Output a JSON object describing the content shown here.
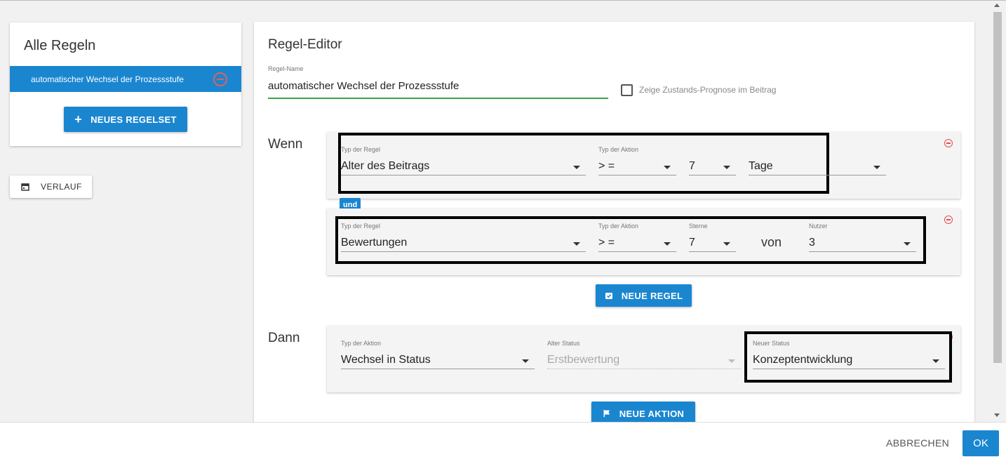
{
  "sidebar": {
    "title": "Alle Regeln",
    "rules": [
      {
        "label": "automatischer Wechsel der Prozessstufe"
      }
    ],
    "new_ruleset_label": "NEUES REGELSET",
    "history_label": "VERLAUF"
  },
  "editor": {
    "title": "Regel-Editor",
    "name_label": "Regel-Name",
    "name_value": "automatischer Wechsel der Prozessstufe",
    "forecast_checkbox_label": "Zeige Zustands-Prognose im Beitrag",
    "forecast_checked": false,
    "wenn_label": "Wenn",
    "dann_label": "Dann",
    "conditions": [
      {
        "rule_type_label": "Typ der Regel",
        "rule_type_value": "Alter des Beitrags",
        "action_type_label": "Typ der Aktion",
        "operator_value": "> =",
        "number_value": "7",
        "unit_value": "Tage"
      },
      {
        "rule_type_label": "Typ der Regel",
        "rule_type_value": "Bewertungen",
        "action_type_label": "Typ der Aktion",
        "operator_value": "> =",
        "stars_label": "Sterne",
        "stars_value": "7",
        "von_text": "von",
        "users_label": "Nutzer",
        "users_value": "3"
      }
    ],
    "connector_label": "und",
    "new_rule_label": "NEUE REGEL",
    "action": {
      "action_type_label": "Typ der Aktion",
      "action_type_value": "Wechsel in Status",
      "old_status_label": "Alter Status",
      "old_status_value": "Erstbewertung",
      "new_status_label": "Neuer Status",
      "new_status_value": "Konzeptentwicklung"
    },
    "new_action_label": "NEUE AKTION"
  },
  "footer": {
    "cancel_label": "ABBRECHEN",
    "ok_label": "OK"
  },
  "colors": {
    "primary": "#1a86d0",
    "input_focus": "#3aa546",
    "remove": "#e05050",
    "highlight": "#000000"
  },
  "icons": [
    "plus-icon",
    "calendar-icon",
    "remove-circle-icon",
    "add-rule-icon",
    "flag-icon",
    "dropdown-caret-icon"
  ]
}
